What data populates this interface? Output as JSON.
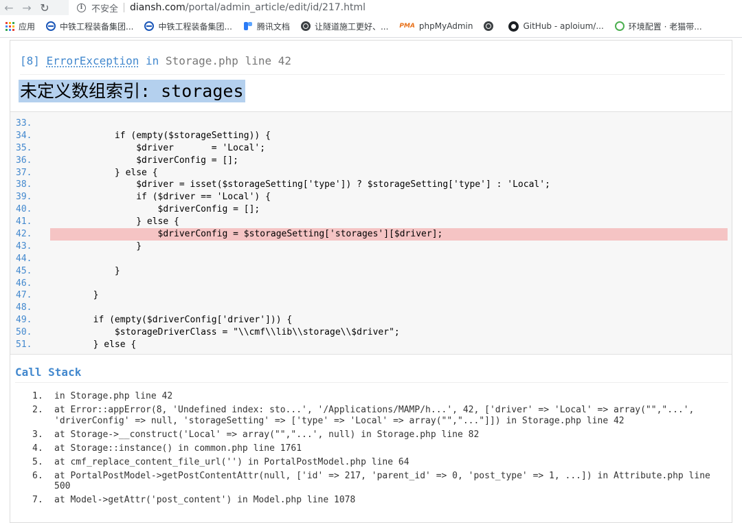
{
  "browser": {
    "back_icon": "arrow-left-icon",
    "forward_icon": "arrow-right-icon",
    "reload_icon": "reload-icon",
    "security_label": "不安全",
    "url_host": "diansh.com",
    "url_path": "/portal/admin_article/edit/id/217.html",
    "bookmarks": [
      {
        "label": "应用",
        "icon": "apps-grid-icon"
      },
      {
        "label": "中铁工程装备集团...",
        "icon": "crrc-logo-icon"
      },
      {
        "label": "中铁工程装备集团...",
        "icon": "crrc-logo-icon"
      },
      {
        "label": "腾讯文档",
        "icon": "tencent-docs-icon"
      },
      {
        "label": "让隧道施工更好、...",
        "icon": "globe-icon"
      },
      {
        "label": "phpMyAdmin",
        "icon": "phpmyadmin-icon"
      },
      {
        "label": "",
        "icon": "globe-icon"
      },
      {
        "label": "GitHub - aploium/...",
        "icon": "github-icon"
      },
      {
        "label": "环境配置 · 老猫带...",
        "icon": "leaf-icon"
      }
    ]
  },
  "exception": {
    "code": "[8]",
    "class_name": "ErrorException",
    "in_word": "in",
    "file": "Storage.php",
    "line_word": "line",
    "line": "42",
    "message": "未定义数组索引: storages"
  },
  "source": {
    "highlight_line": "42.",
    "lines": [
      {
        "n": "33.",
        "code": ""
      },
      {
        "n": "34.",
        "code": "            if (empty($storageSetting)) {"
      },
      {
        "n": "35.",
        "code": "                $driver       = 'Local';"
      },
      {
        "n": "36.",
        "code": "                $driverConfig = [];"
      },
      {
        "n": "37.",
        "code": "            } else {"
      },
      {
        "n": "38.",
        "code": "                $driver = isset($storageSetting['type']) ? $storageSetting['type'] : 'Local';"
      },
      {
        "n": "39.",
        "code": "                if ($driver == 'Local') {"
      },
      {
        "n": "40.",
        "code": "                    $driverConfig = [];"
      },
      {
        "n": "41.",
        "code": "                } else {"
      },
      {
        "n": "42.",
        "code": "                    $driverConfig = $storageSetting['storages'][$driver];"
      },
      {
        "n": "43.",
        "code": "                }"
      },
      {
        "n": "44.",
        "code": ""
      },
      {
        "n": "45.",
        "code": "            }"
      },
      {
        "n": "46.",
        "code": ""
      },
      {
        "n": "47.",
        "code": "        }"
      },
      {
        "n": "48.",
        "code": ""
      },
      {
        "n": "49.",
        "code": "        if (empty($driverConfig['driver'])) {"
      },
      {
        "n": "50.",
        "code": "            $storageDriverClass = \"\\\\cmf\\\\lib\\\\storage\\\\$driver\";"
      },
      {
        "n": "51.",
        "code": "        } else {"
      }
    ]
  },
  "call_stack": {
    "title": "Call Stack",
    "items": [
      {
        "n": "1.",
        "text": "in Storage.php line 42"
      },
      {
        "n": "2.",
        "text": "at Error::appError(8, 'Undefined index: sto...', '/Applications/MAMP/h...', 42, ['driver' => 'Local' => array(\"\",\"...', 'driverConfig' => null, 'storageSetting' => ['type' => 'Local' => array(\"\",\"...\"]]) in Storage.php line 42"
      },
      {
        "n": "3.",
        "text": "at Storage->__construct('Local' => array(\"\",\"...', null) in Storage.php line 82"
      },
      {
        "n": "4.",
        "text": "at Storage::instance() in common.php line 1761"
      },
      {
        "n": "5.",
        "text": "at cmf_replace_content_file_url('') in PortalPostModel.php line 64"
      },
      {
        "n": "6.",
        "text": "at PortalPostModel->getPostContentAttr(null, ['id' => 217, 'parent_id' => 0, 'post_type' => 1, ...]) in Attribute.php line 500"
      },
      {
        "n": "7.",
        "text": "at Model->getAttr('post_content') in Model.php line 1078"
      }
    ]
  }
}
